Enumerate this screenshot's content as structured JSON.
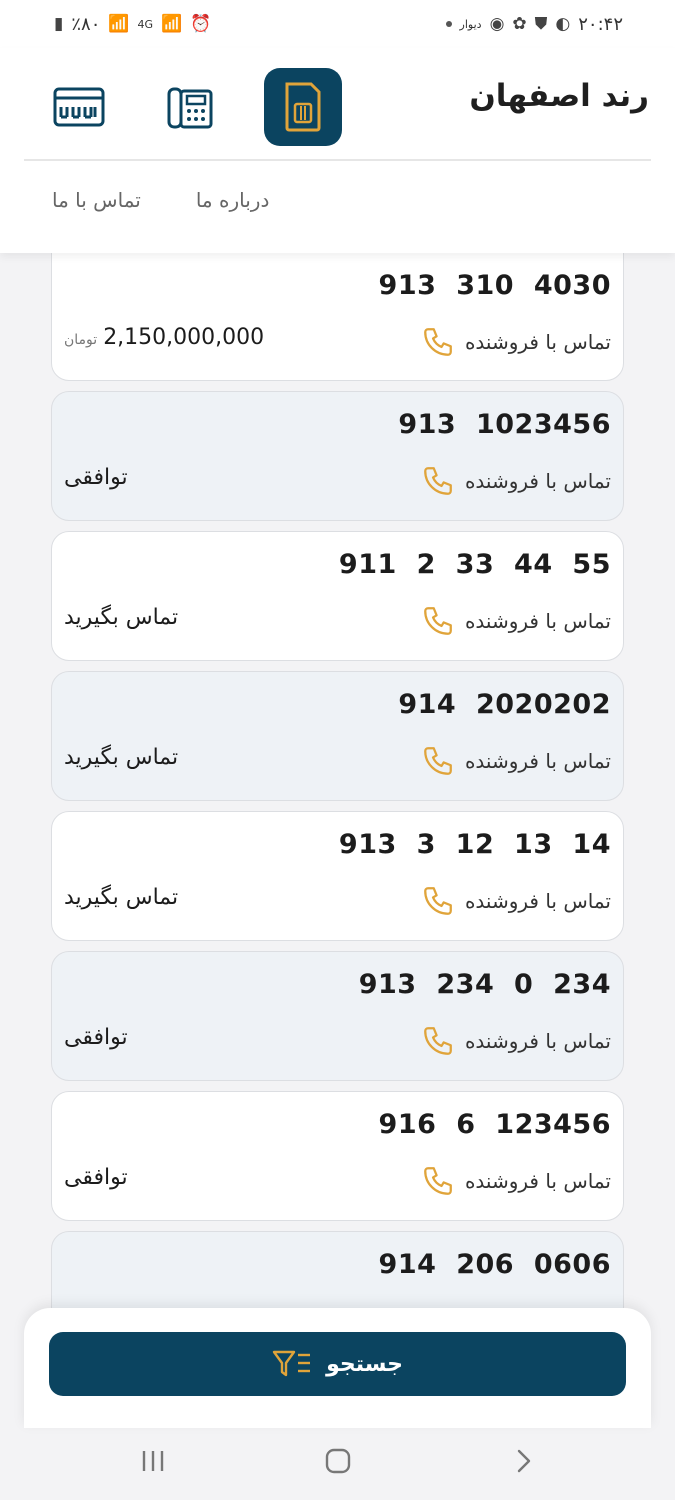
{
  "status_bar": {
    "time": "۲۰:۴۲",
    "battery": "٪۸۰",
    "network": "4G",
    "app_label": "دیوار"
  },
  "header": {
    "brand": "رند اصفهان",
    "nav": {
      "about": "درباره ما",
      "contact": "تماس با ما"
    }
  },
  "call_label": "تماس با فروشنده",
  "listings": [
    {
      "number": "913  310  4030",
      "price": "2,150,000,000",
      "unit": "تومان",
      "status": ""
    },
    {
      "number": "913  1023456",
      "price": "",
      "unit": "",
      "status": "توافقی"
    },
    {
      "number": "911  2  33  44  55",
      "price": "",
      "unit": "",
      "status": "تماس بگیرید"
    },
    {
      "number": "914  2020202",
      "price": "",
      "unit": "",
      "status": "تماس بگیرید"
    },
    {
      "number": "913  3  12  13  14",
      "price": "",
      "unit": "",
      "status": "تماس بگیرید"
    },
    {
      "number": "913  234  0  234",
      "price": "",
      "unit": "",
      "status": "توافقی"
    },
    {
      "number": "916  6  123456",
      "price": "",
      "unit": "",
      "status": "توافقی"
    },
    {
      "number": "914  206  0606",
      "price": "",
      "unit": "",
      "status": ""
    }
  ],
  "search": {
    "label": "جستجو"
  },
  "colors": {
    "primary": "#0b4460",
    "accent": "#e0a43a",
    "card_alt": "#eef2f6"
  },
  "icons": {
    "sim": "sim-card-icon",
    "phone": "desk-phone-icon",
    "plate": "keyboard-icon",
    "call": "phone-icon",
    "filter": "filter-icon"
  }
}
